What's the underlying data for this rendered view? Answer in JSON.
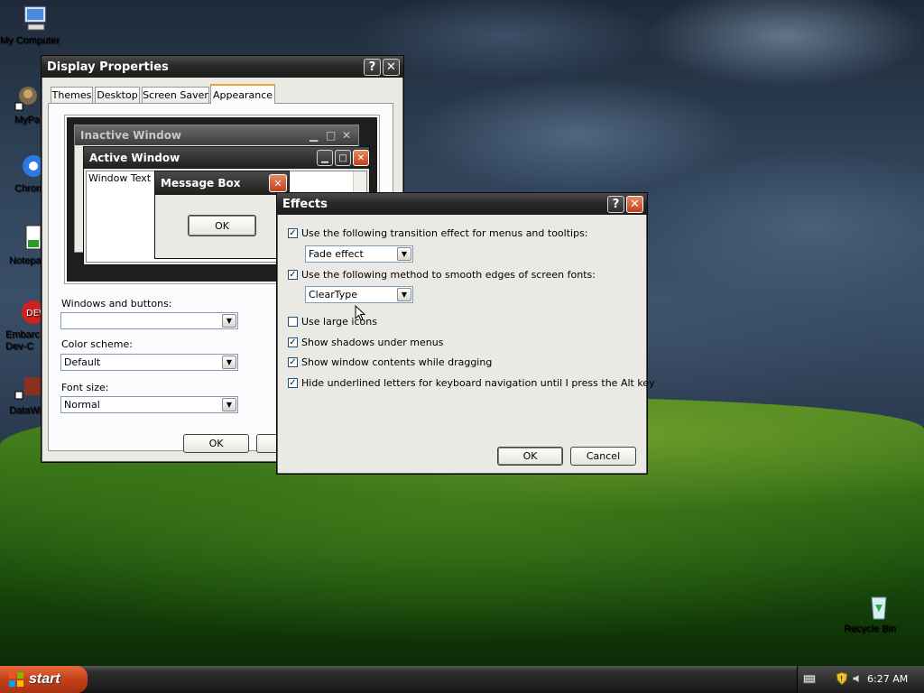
{
  "desktop_icons": [
    {
      "label": "My Computer"
    },
    {
      "label": "MyPa"
    },
    {
      "label": "Chrom"
    },
    {
      "label": "Notepa"
    },
    {
      "label": "Embarc\nDev-C"
    },
    {
      "label": "DataWa"
    },
    {
      "label": "Recycle Bin"
    }
  ],
  "display_properties": {
    "title": "Display Properties",
    "help_btn": "?",
    "close_btn": "✕",
    "tabs": [
      "Themes",
      "Desktop",
      "Screen Saver",
      "Appearance"
    ],
    "selected_tab": "Appearance",
    "preview": {
      "inactive_title": "Inactive Window",
      "active_title": "Active Window",
      "window_text": "Window Text",
      "msgbox_title": "Message Box",
      "msgbox_ok": "OK"
    },
    "windows_buttons_label": "Windows and buttons:",
    "windows_buttons_value": "",
    "color_scheme_label": "Color scheme:",
    "color_scheme_value": "Default",
    "font_size_label": "Font size:",
    "font_size_value": "Normal",
    "ok_label": "OK"
  },
  "effects": {
    "title": "Effects",
    "help_btn": "?",
    "close_btn": "✕",
    "options": [
      {
        "label": "Use the following transition effect for menus and tooltips:",
        "checked": true
      },
      {
        "label": "Use the following method to smooth edges of screen fonts:",
        "checked": true
      },
      {
        "label": "Use large icons",
        "checked": false
      },
      {
        "label": "Show shadows under menus",
        "checked": true
      },
      {
        "label": "Show window contents while dragging",
        "checked": true
      },
      {
        "label": "Hide underlined letters for keyboard navigation until I press the Alt key",
        "checked": true
      }
    ],
    "transition_value": "Fade effect",
    "smoothing_value": "ClearType",
    "ok_label": "OK",
    "cancel_label": "Cancel"
  },
  "taskbar": {
    "start_label": "start",
    "clock": "6:27 AM"
  },
  "colors": {
    "accent": "#e8a830",
    "close_red": "#c0401a",
    "start_orange": "#c4401a"
  }
}
